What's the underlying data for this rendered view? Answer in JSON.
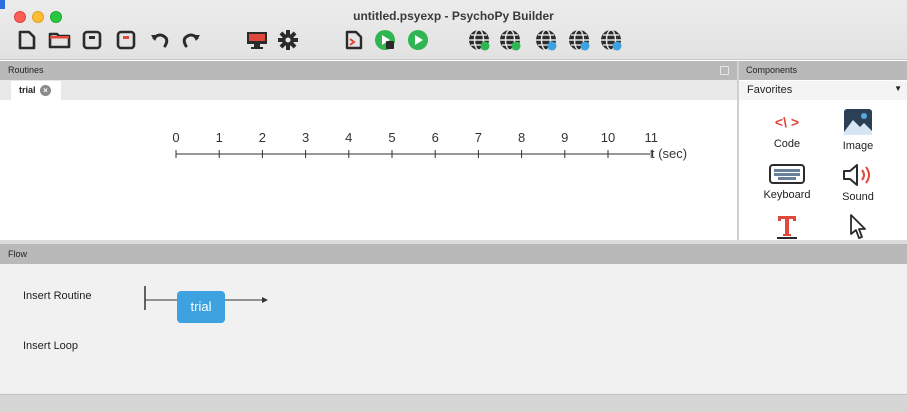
{
  "window": {
    "title": "untitled.psyexp - PsychoPy Builder"
  },
  "toolbar": {
    "items": [
      "new-file-icon",
      "open-folder-icon",
      "save-icon",
      "save-as-icon",
      "undo-icon",
      "redo-icon",
      "monitor-icon",
      "settings-gear-icon",
      "compile-script-icon",
      "run-icon",
      "pilot-icon",
      "pavlovia-sync-icon",
      "pavlovia-search-icon",
      "pavlovia-user-icon",
      "pavlovia-project-icon",
      "pavlovia-info-icon"
    ]
  },
  "routines": {
    "header": "Routines",
    "tabs": [
      {
        "label": "trial"
      }
    ],
    "timeline": {
      "ticks": [
        "0",
        "1",
        "2",
        "3",
        "4",
        "5",
        "6",
        "7",
        "8",
        "9",
        "10",
        "11"
      ],
      "unit_label": "t (sec)"
    }
  },
  "components": {
    "header": "Components",
    "category": "Favorites",
    "items": [
      {
        "label": "Code",
        "icon": "code-icon"
      },
      {
        "label": "Image",
        "icon": "image-icon"
      },
      {
        "label": "Keyboard",
        "icon": "keyboard-icon"
      },
      {
        "label": "Sound",
        "icon": "speaker-icon"
      },
      {
        "label": "",
        "icon": "text-icon"
      },
      {
        "label": "",
        "icon": "mouse-cursor-icon"
      }
    ]
  },
  "flow": {
    "header": "Flow",
    "insert_routine": "Insert Routine",
    "insert_loop": "Insert Loop",
    "routines": [
      "trial"
    ]
  },
  "colors": {
    "accent_blue": "#3fa2e0",
    "code_red": "#e0483c",
    "play_green": "#2fb551"
  }
}
